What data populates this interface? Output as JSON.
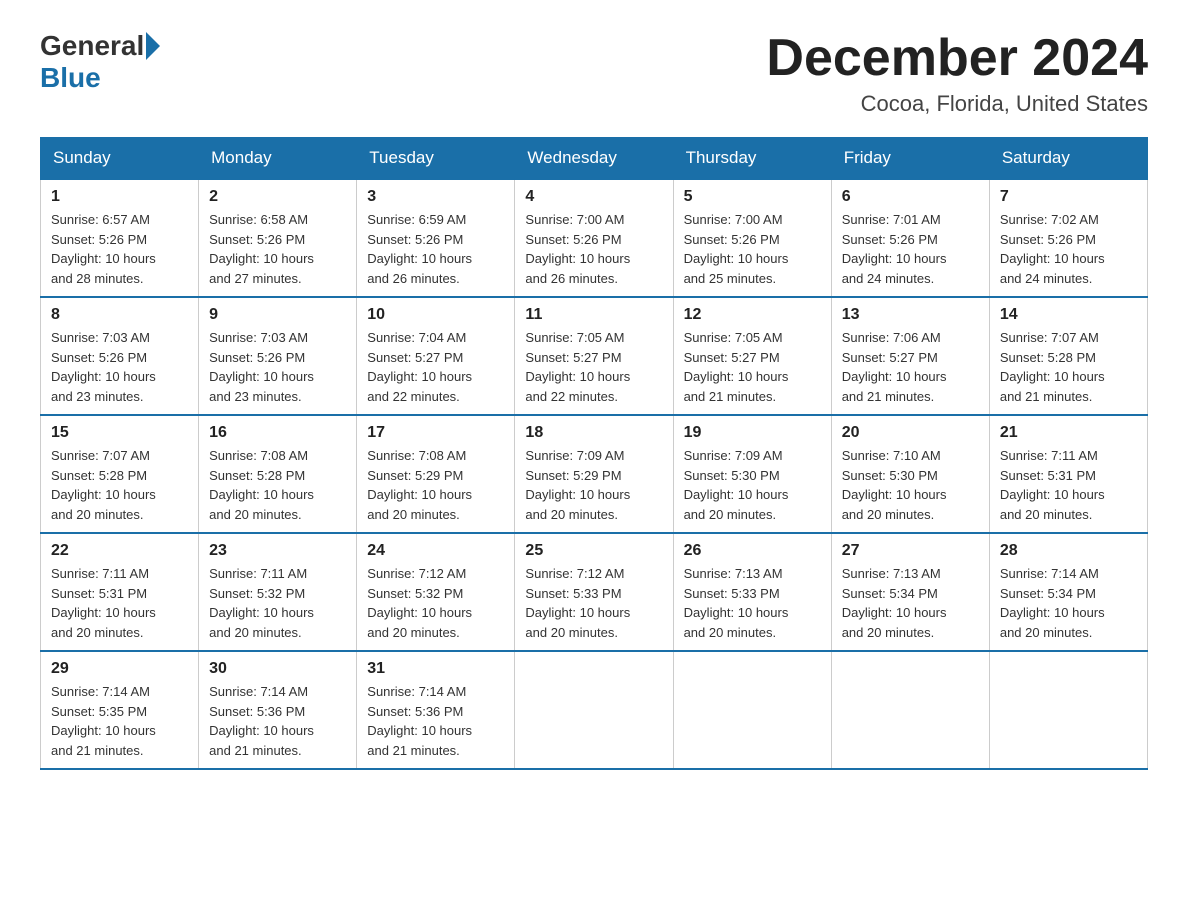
{
  "logo": {
    "general": "General",
    "blue": "Blue"
  },
  "title": "December 2024",
  "location": "Cocoa, Florida, United States",
  "weekdays": [
    "Sunday",
    "Monday",
    "Tuesday",
    "Wednesday",
    "Thursday",
    "Friday",
    "Saturday"
  ],
  "weeks": [
    [
      {
        "day": 1,
        "sunrise": "6:57 AM",
        "sunset": "5:26 PM",
        "daylight": "10 hours and 28 minutes."
      },
      {
        "day": 2,
        "sunrise": "6:58 AM",
        "sunset": "5:26 PM",
        "daylight": "10 hours and 27 minutes."
      },
      {
        "day": 3,
        "sunrise": "6:59 AM",
        "sunset": "5:26 PM",
        "daylight": "10 hours and 26 minutes."
      },
      {
        "day": 4,
        "sunrise": "7:00 AM",
        "sunset": "5:26 PM",
        "daylight": "10 hours and 26 minutes."
      },
      {
        "day": 5,
        "sunrise": "7:00 AM",
        "sunset": "5:26 PM",
        "daylight": "10 hours and 25 minutes."
      },
      {
        "day": 6,
        "sunrise": "7:01 AM",
        "sunset": "5:26 PM",
        "daylight": "10 hours and 24 minutes."
      },
      {
        "day": 7,
        "sunrise": "7:02 AM",
        "sunset": "5:26 PM",
        "daylight": "10 hours and 24 minutes."
      }
    ],
    [
      {
        "day": 8,
        "sunrise": "7:03 AM",
        "sunset": "5:26 PM",
        "daylight": "10 hours and 23 minutes."
      },
      {
        "day": 9,
        "sunrise": "7:03 AM",
        "sunset": "5:26 PM",
        "daylight": "10 hours and 23 minutes."
      },
      {
        "day": 10,
        "sunrise": "7:04 AM",
        "sunset": "5:27 PM",
        "daylight": "10 hours and 22 minutes."
      },
      {
        "day": 11,
        "sunrise": "7:05 AM",
        "sunset": "5:27 PM",
        "daylight": "10 hours and 22 minutes."
      },
      {
        "day": 12,
        "sunrise": "7:05 AM",
        "sunset": "5:27 PM",
        "daylight": "10 hours and 21 minutes."
      },
      {
        "day": 13,
        "sunrise": "7:06 AM",
        "sunset": "5:27 PM",
        "daylight": "10 hours and 21 minutes."
      },
      {
        "day": 14,
        "sunrise": "7:07 AM",
        "sunset": "5:28 PM",
        "daylight": "10 hours and 21 minutes."
      }
    ],
    [
      {
        "day": 15,
        "sunrise": "7:07 AM",
        "sunset": "5:28 PM",
        "daylight": "10 hours and 20 minutes."
      },
      {
        "day": 16,
        "sunrise": "7:08 AM",
        "sunset": "5:28 PM",
        "daylight": "10 hours and 20 minutes."
      },
      {
        "day": 17,
        "sunrise": "7:08 AM",
        "sunset": "5:29 PM",
        "daylight": "10 hours and 20 minutes."
      },
      {
        "day": 18,
        "sunrise": "7:09 AM",
        "sunset": "5:29 PM",
        "daylight": "10 hours and 20 minutes."
      },
      {
        "day": 19,
        "sunrise": "7:09 AM",
        "sunset": "5:30 PM",
        "daylight": "10 hours and 20 minutes."
      },
      {
        "day": 20,
        "sunrise": "7:10 AM",
        "sunset": "5:30 PM",
        "daylight": "10 hours and 20 minutes."
      },
      {
        "day": 21,
        "sunrise": "7:11 AM",
        "sunset": "5:31 PM",
        "daylight": "10 hours and 20 minutes."
      }
    ],
    [
      {
        "day": 22,
        "sunrise": "7:11 AM",
        "sunset": "5:31 PM",
        "daylight": "10 hours and 20 minutes."
      },
      {
        "day": 23,
        "sunrise": "7:11 AM",
        "sunset": "5:32 PM",
        "daylight": "10 hours and 20 minutes."
      },
      {
        "day": 24,
        "sunrise": "7:12 AM",
        "sunset": "5:32 PM",
        "daylight": "10 hours and 20 minutes."
      },
      {
        "day": 25,
        "sunrise": "7:12 AM",
        "sunset": "5:33 PM",
        "daylight": "10 hours and 20 minutes."
      },
      {
        "day": 26,
        "sunrise": "7:13 AM",
        "sunset": "5:33 PM",
        "daylight": "10 hours and 20 minutes."
      },
      {
        "day": 27,
        "sunrise": "7:13 AM",
        "sunset": "5:34 PM",
        "daylight": "10 hours and 20 minutes."
      },
      {
        "day": 28,
        "sunrise": "7:14 AM",
        "sunset": "5:34 PM",
        "daylight": "10 hours and 20 minutes."
      }
    ],
    [
      {
        "day": 29,
        "sunrise": "7:14 AM",
        "sunset": "5:35 PM",
        "daylight": "10 hours and 21 minutes."
      },
      {
        "day": 30,
        "sunrise": "7:14 AM",
        "sunset": "5:36 PM",
        "daylight": "10 hours and 21 minutes."
      },
      {
        "day": 31,
        "sunrise": "7:14 AM",
        "sunset": "5:36 PM",
        "daylight": "10 hours and 21 minutes."
      },
      null,
      null,
      null,
      null
    ]
  ],
  "labels": {
    "sunrise": "Sunrise:",
    "sunset": "Sunset:",
    "daylight": "Daylight:"
  }
}
